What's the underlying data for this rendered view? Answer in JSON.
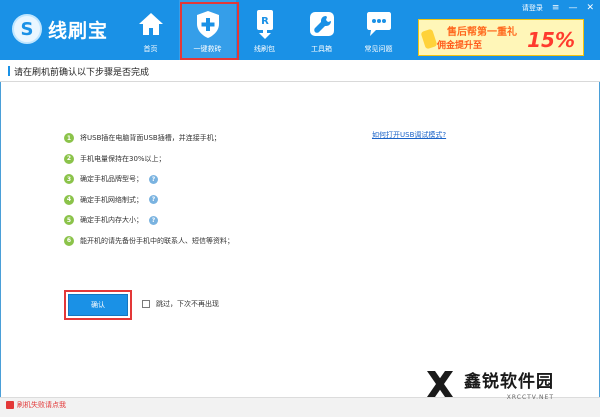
{
  "app": {
    "logo_text": "线刷宝",
    "login": "请登录"
  },
  "nav": [
    {
      "label": "首页",
      "icon": "home-icon"
    },
    {
      "label": "一键救砖",
      "icon": "shield-plus-icon",
      "active": true
    },
    {
      "label": "线刷包",
      "icon": "rom-package-icon"
    },
    {
      "label": "工具箱",
      "icon": "wrench-icon"
    },
    {
      "label": "常见问题",
      "icon": "chat-bubble-icon"
    }
  ],
  "banner": {
    "line1": "售后帮第一重礼",
    "line2": "佣金提升至",
    "pct": "15%"
  },
  "title": "请在刷机前确认以下步骤是否完成",
  "steps": [
    {
      "num": "1",
      "text": "将USB插在电脑背面USB插槽，并连接手机；"
    },
    {
      "num": "2",
      "text": "手机电量保持在30%以上；"
    },
    {
      "num": "3",
      "text": "确定手机品牌型号；",
      "help": "?"
    },
    {
      "num": "4",
      "text": "确定手机网络制式；",
      "help": "?"
    },
    {
      "num": "5",
      "text": "确定手机内存大小；",
      "help": "?"
    },
    {
      "num": "6",
      "text": "能开机的请先备份手机中的联系人、短信等资料；"
    }
  ],
  "usb_link": "如何打开USB调试模式?",
  "confirm": "确认",
  "skip": "跳过，下次不再出现",
  "fail": "刷机失败请点我",
  "watermark": {
    "main": "鑫锐软件园",
    "sub": "XRCCTV.NET"
  },
  "colors": {
    "topbar": "#1a91e6",
    "highlight": "#e33838",
    "step_num": "#8bc34a",
    "link": "#1a63c8"
  }
}
